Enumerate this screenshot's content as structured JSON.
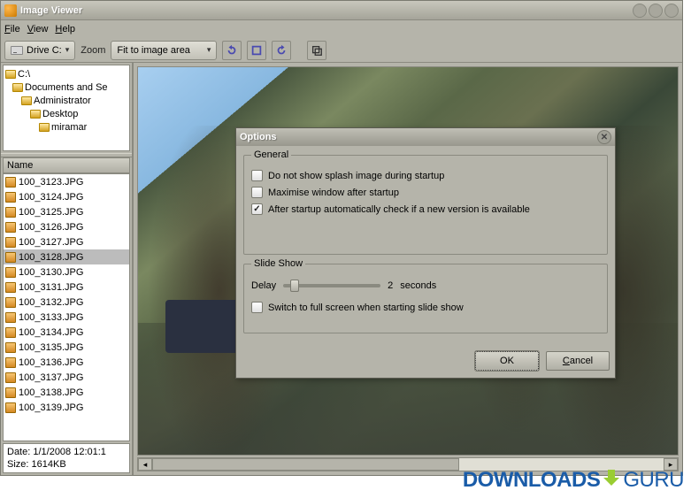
{
  "window": {
    "title": "Image Viewer"
  },
  "menu": {
    "file": "File",
    "view": "View",
    "help": "Help"
  },
  "toolbar": {
    "drive_label": "Drive C:",
    "zoom_label": "Zoom",
    "zoom_value": "Fit to image area"
  },
  "tree": {
    "items": [
      {
        "label": "C:\\",
        "depth": 0
      },
      {
        "label": "Documents and Se",
        "depth": 1
      },
      {
        "label": "Administrator",
        "depth": 2
      },
      {
        "label": "Desktop",
        "depth": 3
      },
      {
        "label": "miramar",
        "depth": 4
      }
    ]
  },
  "filelist": {
    "header": "Name",
    "selected_index": 5,
    "items": [
      "100_3123.JPG",
      "100_3124.JPG",
      "100_3125.JPG",
      "100_3126.JPG",
      "100_3127.JPG",
      "100_3128.JPG",
      "100_3130.JPG",
      "100_3131.JPG",
      "100_3132.JPG",
      "100_3133.JPG",
      "100_3134.JPG",
      "100_3135.JPG",
      "100_3136.JPG",
      "100_3137.JPG",
      "100_3138.JPG",
      "100_3139.JPG"
    ]
  },
  "status": {
    "date": "Date: 1/1/2008 12:01:1",
    "size": "Size: 1614KB"
  },
  "dialog": {
    "title": "Options",
    "general": {
      "legend": "General",
      "opt1": "Do not show splash image during startup",
      "opt2": "Maximise window after startup",
      "opt3": "After startup automatically check if a new version is available"
    },
    "slideshow": {
      "legend": "Slide Show",
      "delay_label": "Delay",
      "delay_value": "2",
      "delay_unit": "seconds",
      "fullscreen": "Switch to full screen when starting slide show"
    },
    "ok": "OK",
    "cancel": "Cancel"
  },
  "watermark": {
    "part1": "DOWNLOADS",
    "part2": "GURU"
  }
}
